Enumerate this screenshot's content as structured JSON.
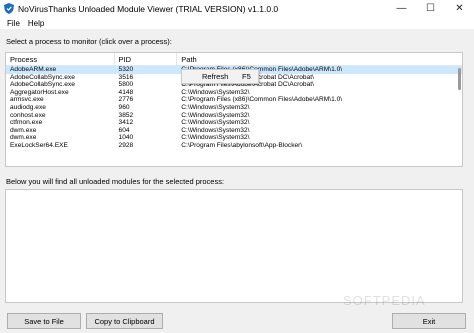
{
  "window": {
    "title": "NoVirusThanks Unloaded Module Viewer (TRIAL VERSION) v1.1.0.0",
    "minimize_glyph": "—",
    "maximize_glyph": "☐",
    "close_glyph": "✕"
  },
  "menu": [
    "File",
    "Help"
  ],
  "select_label": "Select a process to monitor (click over a process):",
  "table": {
    "columns": [
      "Process",
      "PID",
      "Path"
    ],
    "rows": [
      {
        "process": "AdobeARM.exe",
        "pid": "5320",
        "path": "C:\\Program Files (x86)\\Common Files\\Adobe\\ARM\\1.0\\"
      },
      {
        "process": "AdobeCollabSync.exe",
        "pid": "3516",
        "path": "C:\\Program Files\\Adobe\\Acrobat DC\\Acrobat\\"
      },
      {
        "process": "AdobeCollabSync.exe",
        "pid": "5800",
        "path": "C:\\Program Files\\Adobe\\Acrobat DC\\Acrobat\\"
      },
      {
        "process": "AggregatorHost.exe",
        "pid": "4148",
        "path": "C:\\Windows\\System32\\"
      },
      {
        "process": "armsvc.exe",
        "pid": "2776",
        "path": "C:\\Program Files (x86)\\Common Files\\Adobe\\ARM\\1.0\\"
      },
      {
        "process": "audiodg.exe",
        "pid": "960",
        "path": "C:\\Windows\\System32\\"
      },
      {
        "process": "conhost.exe",
        "pid": "3852",
        "path": "C:\\Windows\\System32\\"
      },
      {
        "process": "ctfmon.exe",
        "pid": "3412",
        "path": "C:\\Windows\\System32\\"
      },
      {
        "process": "dwm.exe",
        "pid": "604",
        "path": "C:\\Windows\\System32\\"
      },
      {
        "process": "dwm.exe",
        "pid": "1040",
        "path": "C:\\Windows\\System32\\"
      },
      {
        "process": "ExeLockSer64.EXE",
        "pid": "2928",
        "path": "C:\\Program Files\\abylonsoft\\App-Blocker\\"
      }
    ]
  },
  "context_menu": {
    "label": "Refresh",
    "shortcut": "F5"
  },
  "modules_label": "Below you will find all unloaded modules for the selected process:",
  "buttons": {
    "save": "Save to File",
    "copy": "Copy to Clipboard",
    "exit": "Exit"
  },
  "watermark": "SOFTPEDIA",
  "colors": {
    "selected_row": "#cce8ff",
    "window_bg": "#f0f0f0"
  }
}
